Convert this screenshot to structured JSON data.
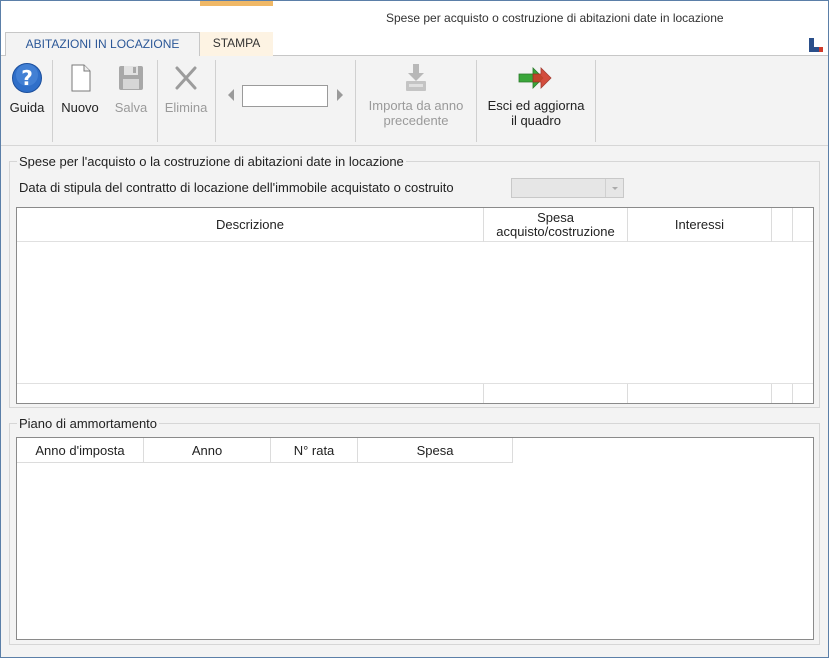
{
  "window": {
    "title": "Spese per acquisto o costruzione di abitazioni date in locazione"
  },
  "tabs": [
    {
      "label": "ABITAZIONI IN LOCAZIONE",
      "active": true
    },
    {
      "label": "STAMPA",
      "active": false
    }
  ],
  "toolbar": {
    "guida": "Guida",
    "nuovo": "Nuovo",
    "salva": "Salva",
    "elimina": "Elimina",
    "record_value": "",
    "importa_line1": "Importa da anno",
    "importa_line2": "precedente",
    "esci_line1": "Esci ed aggiorna",
    "esci_line2": "il quadro"
  },
  "section1": {
    "title": "Spese per l'acquisto o la costruzione di abitazioni date in locazione",
    "date_label": "Data di stipula del contratto di locazione dell'immobile acquistato o costruito",
    "date_value": "",
    "columns": [
      "Descrizione",
      "Spesa acquisto/costruzione",
      "Interessi"
    ],
    "col_spesa_line1": "Spesa",
    "col_spesa_line2": "acquisto/costruzione"
  },
  "section2": {
    "title": "Piano di ammortamento",
    "columns": [
      "Anno d'imposta",
      "Anno",
      "N° rata",
      "Spesa"
    ]
  },
  "colors": {
    "tab_active_text": "#2b5797",
    "stampa_accent": "#f0b866",
    "help_icon": "#2f6fc9",
    "arrow_green": "#3aa63a",
    "arrow_red": "#d03a2a"
  }
}
